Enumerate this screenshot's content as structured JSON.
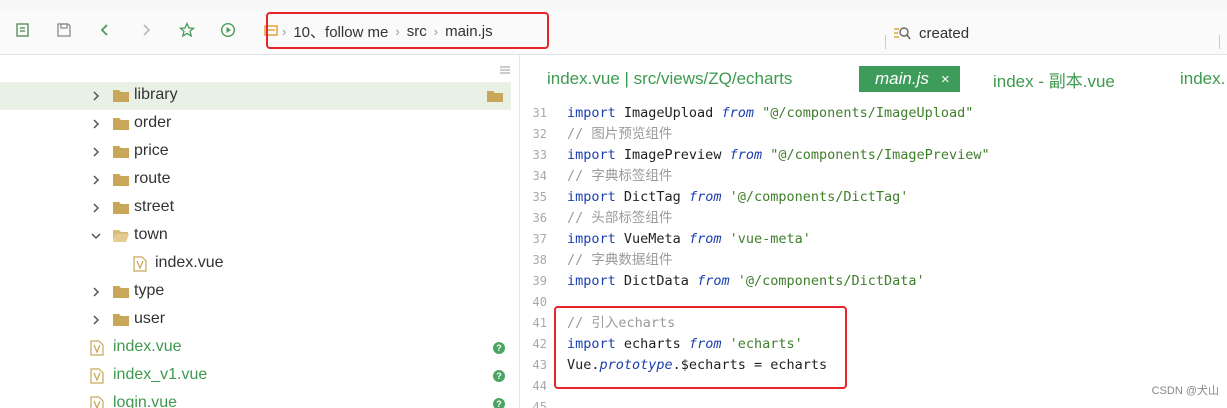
{
  "toolbar": {
    "breadcrumb": [
      "10、follow me",
      "src",
      "main.js"
    ],
    "search_value": "created"
  },
  "tree": {
    "items": [
      {
        "label": "library",
        "kind": "folder",
        "expanded": false,
        "selected": true
      },
      {
        "label": "order",
        "kind": "folder",
        "expanded": false
      },
      {
        "label": "price",
        "kind": "folder",
        "expanded": false
      },
      {
        "label": "route",
        "kind": "folder",
        "expanded": false
      },
      {
        "label": "street",
        "kind": "folder",
        "expanded": false
      },
      {
        "label": "town",
        "kind": "folder",
        "expanded": true
      },
      {
        "label": "index.vue",
        "kind": "file"
      },
      {
        "label": "type",
        "kind": "folder",
        "expanded": false
      },
      {
        "label": "user",
        "kind": "folder",
        "expanded": false
      },
      {
        "label": "index.vue",
        "kind": "file",
        "status": "?"
      },
      {
        "label": "index_v1.vue",
        "kind": "file",
        "status": "?"
      },
      {
        "label": "login.vue",
        "kind": "file",
        "status": "?"
      }
    ]
  },
  "editor": {
    "tabs": [
      {
        "label": "index.vue | src/views/ZQ/echarts",
        "active": false
      },
      {
        "label": "main.js",
        "active": true,
        "close": "×"
      },
      {
        "label": "index - 副本.vue",
        "active": false
      },
      {
        "label": "index.",
        "active": false
      }
    ],
    "lines": [
      {
        "n": "31",
        "tokens": [
          [
            "kw",
            "import"
          ],
          [
            "ident",
            " ImageUpload "
          ],
          [
            "it",
            "from"
          ],
          [
            "ident",
            " "
          ],
          [
            "str",
            "\"@/components/ImageUpload\""
          ]
        ]
      },
      {
        "n": "32",
        "tokens": [
          [
            "cmt",
            "// 图片预览组件"
          ]
        ]
      },
      {
        "n": "33",
        "tokens": [
          [
            "kw",
            "import"
          ],
          [
            "ident",
            " ImagePreview "
          ],
          [
            "it",
            "from"
          ],
          [
            "ident",
            " "
          ],
          [
            "str",
            "\"@/components/ImagePreview\""
          ]
        ]
      },
      {
        "n": "34",
        "tokens": [
          [
            "cmt",
            "// 字典标签组件"
          ]
        ]
      },
      {
        "n": "35",
        "tokens": [
          [
            "kw",
            "import"
          ],
          [
            "ident",
            " DictTag "
          ],
          [
            "it",
            "from"
          ],
          [
            "ident",
            " "
          ],
          [
            "str",
            "'@/components/DictTag'"
          ]
        ]
      },
      {
        "n": "36",
        "tokens": [
          [
            "cmt",
            "// 头部标签组件"
          ]
        ]
      },
      {
        "n": "37",
        "tokens": [
          [
            "kw",
            "import"
          ],
          [
            "ident",
            " VueMeta "
          ],
          [
            "it",
            "from"
          ],
          [
            "ident",
            " "
          ],
          [
            "str",
            "'vue-meta'"
          ]
        ]
      },
      {
        "n": "38",
        "tokens": [
          [
            "cmt",
            "// 字典数据组件"
          ]
        ]
      },
      {
        "n": "39",
        "tokens": [
          [
            "kw",
            "import"
          ],
          [
            "ident",
            " DictData "
          ],
          [
            "it",
            "from"
          ],
          [
            "ident",
            " "
          ],
          [
            "str",
            "'@/components/DictData'"
          ]
        ]
      },
      {
        "n": "40",
        "tokens": []
      },
      {
        "n": "41",
        "tokens": [
          [
            "cmt",
            "// 引入echarts"
          ]
        ]
      },
      {
        "n": "42",
        "tokens": [
          [
            "kw",
            "import"
          ],
          [
            "ident",
            " echarts "
          ],
          [
            "it",
            "from"
          ],
          [
            "ident",
            " "
          ],
          [
            "str",
            "'echarts'"
          ]
        ]
      },
      {
        "n": "43",
        "tokens": [
          [
            "ident",
            "Vue."
          ],
          [
            "it",
            "prototype"
          ],
          [
            "ident",
            ".$echarts = echarts"
          ]
        ]
      },
      {
        "n": "44",
        "tokens": []
      },
      {
        "n": "45",
        "tokens": []
      }
    ]
  },
  "watermark": "CSDN @犬山",
  "colors": {
    "accent_green": "#3e9c5a",
    "highlight_red": "#e8232a",
    "keyword_blue": "#1b3fb0",
    "string_green": "#3f7e2a"
  }
}
